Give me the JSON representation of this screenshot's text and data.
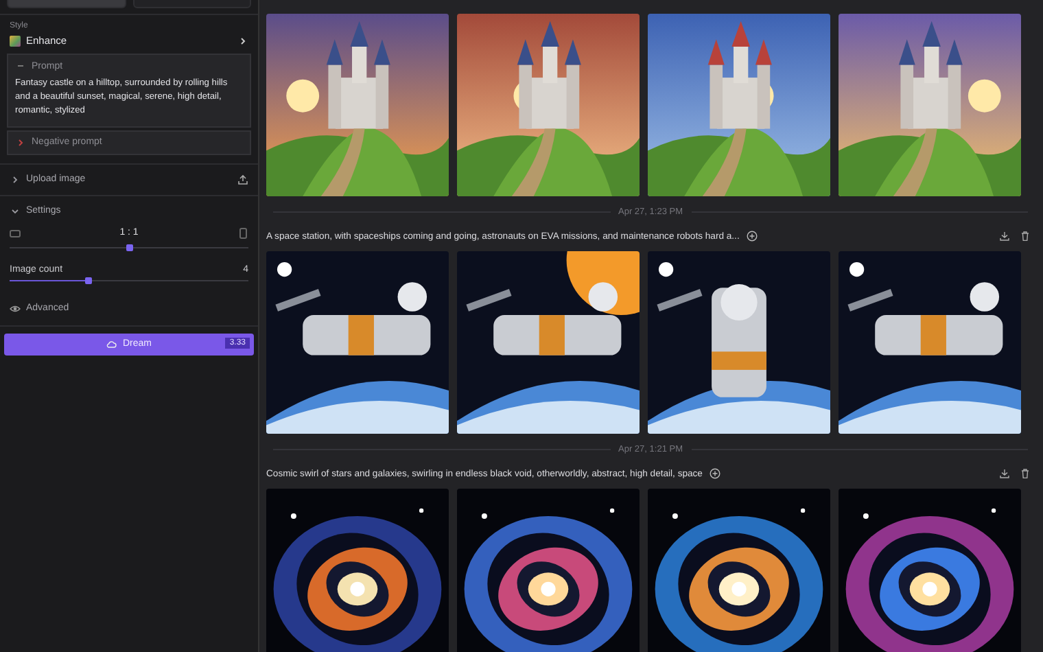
{
  "sidebar": {
    "tabs": [
      {
        "selected": true
      },
      {
        "selected": false
      }
    ],
    "style": {
      "label": "Style",
      "value": "Enhance"
    },
    "prompt": {
      "label": "Prompt",
      "text": "Fantasy castle on a hilltop, surrounded by rolling hills and a beautiful sunset, magical, serene, high detail, romantic, stylized"
    },
    "negative_prompt": {
      "label": "Negative prompt"
    },
    "upload": {
      "label": "Upload image",
      "expanded": false
    },
    "settings": {
      "label": "Settings",
      "expanded": true,
      "ratio": {
        "reading": "1 : 1",
        "level": 0.5
      },
      "image_count": {
        "label": "Image count",
        "reading": "4",
        "level": 0.33
      }
    },
    "advanced": {
      "label": "Advanced"
    },
    "dream": {
      "label": "Dream",
      "cost": "3.33"
    }
  },
  "feed": [
    {
      "images": [
        {
          "kind": "picture"
        },
        {
          "kind": "picture"
        },
        {
          "kind": "picture"
        },
        {
          "kind": "picture"
        }
      ]
    },
    {
      "date": "Apr 27, 1:23 PM",
      "prompt": "A space station, with spaceships coming and going, astronauts on EVA missions, and maintenance robots hard a...",
      "images": [
        {
          "kind": "picture"
        },
        {
          "kind": "picture"
        },
        {
          "kind": "picture"
        },
        {
          "kind": "picture"
        }
      ]
    },
    {
      "date": "Apr 27, 1:21 PM",
      "prompt": "Cosmic swirl of stars and galaxies, swirling in endless black void, otherworldly, abstract, high detail, space",
      "images": [
        {
          "kind": "picture"
        },
        {
          "kind": "picture"
        },
        {
          "kind": "picture"
        },
        {
          "kind": "picture"
        }
      ]
    }
  ]
}
